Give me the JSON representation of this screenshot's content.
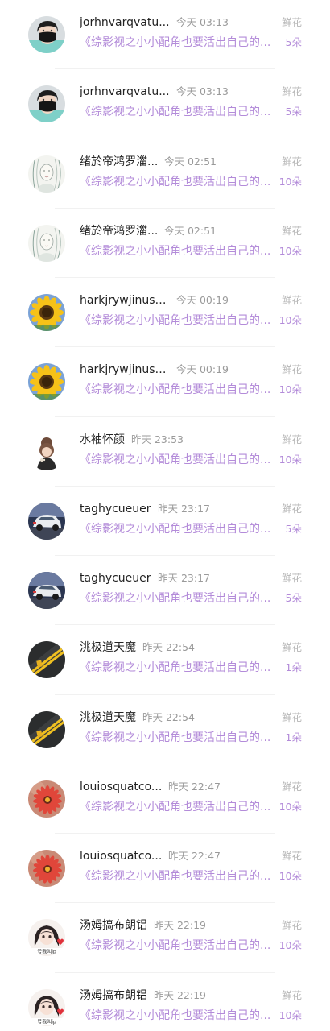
{
  "gift_records": [
    {
      "user": "jorhnvarqvatu...",
      "time": "今天 03:13",
      "gift": "鲜花",
      "book": "《综影视之小小配角也要活出自己的...",
      "count": "5朵",
      "avatar": "avatar-mask-person"
    },
    {
      "user": "jorhnvarqvatu...",
      "time": "今天 03:13",
      "gift": "鲜花",
      "book": "《综影视之小小配角也要活出自己的...",
      "count": "5朵",
      "avatar": "avatar-mask-person"
    },
    {
      "user": "绪於帝鸿罗湽...",
      "time": "今天 02:51",
      "gift": "鲜花",
      "book": "《综影视之小小配角也要活出自己的...",
      "count": "10朵",
      "avatar": "avatar-sketch-portrait"
    },
    {
      "user": "绪於帝鸿罗湽...",
      "time": "今天 02:51",
      "gift": "鲜花",
      "book": "《综影视之小小配角也要活出自己的...",
      "count": "10朵",
      "avatar": "avatar-sketch-portrait"
    },
    {
      "user": "harkjrywjinust...",
      "time": "今天 00:19",
      "gift": "鲜花",
      "book": "《综影视之小小配角也要活出自己的...",
      "count": "10朵",
      "avatar": "avatar-sunflower"
    },
    {
      "user": "harkjrywjinust...",
      "time": "今天 00:19",
      "gift": "鲜花",
      "book": "《综影视之小小配角也要活出自己的...",
      "count": "10朵",
      "avatar": "avatar-sunflower"
    },
    {
      "user": "水袖怀颜",
      "time": "昨天 23:53",
      "gift": "鲜花",
      "book": "《综影视之小小配角也要活出自己的...",
      "count": "10朵",
      "avatar": "avatar-cartoon-girl"
    },
    {
      "user": "taghycueuer",
      "time": "昨天 23:17",
      "gift": "鲜花",
      "book": "《综影视之小小配角也要活出自己的...",
      "count": "5朵",
      "avatar": "avatar-car"
    },
    {
      "user": "taghycueuer",
      "time": "昨天 23:17",
      "gift": "鲜花",
      "book": "《综影视之小小配角也要活出自己的...",
      "count": "5朵",
      "avatar": "avatar-car"
    },
    {
      "user": "洮极道天魔",
      "time": "昨天 22:54",
      "gift": "鲜花",
      "book": "《综影视之小小配角也要活出自己的...",
      "count": "1朵",
      "avatar": "avatar-road"
    },
    {
      "user": "洮极道天魔",
      "time": "昨天 22:54",
      "gift": "鲜花",
      "book": "《综影视之小小配角也要活出自己的...",
      "count": "1朵",
      "avatar": "avatar-road"
    },
    {
      "user": "louiosquatco...",
      "time": "昨天 22:47",
      "gift": "鲜花",
      "book": "《综影视之小小配角也要活出自己的...",
      "count": "10朵",
      "avatar": "avatar-red-flower"
    },
    {
      "user": "louiosquatco...",
      "time": "昨天 22:47",
      "gift": "鲜花",
      "book": "《综影视之小小配角也要活出自己的...",
      "count": "10朵",
      "avatar": "avatar-red-flower"
    },
    {
      "user": "汤姆搞布朗铝",
      "time": "昨天 22:19",
      "gift": "鲜花",
      "book": "《综影视之小小配角也要活出自己的...",
      "count": "10朵",
      "avatar": "avatar-anime-girl"
    },
    {
      "user": "汤姆搞布朗铝",
      "time": "昨天 22:19",
      "gift": "鲜花",
      "book": "《综影视之小小配角也要活出自己的...",
      "count": "10朵",
      "avatar": "avatar-anime-girl"
    }
  ],
  "avatar_captions": {
    "avatar-anime-girl": "号我叫ip"
  },
  "colors": {
    "book_title": "#b38bd9",
    "flower_count": "#b38bd9",
    "username": "#222222",
    "timestamp": "#9a9a9a",
    "gift_label": "#b7b7b7"
  }
}
